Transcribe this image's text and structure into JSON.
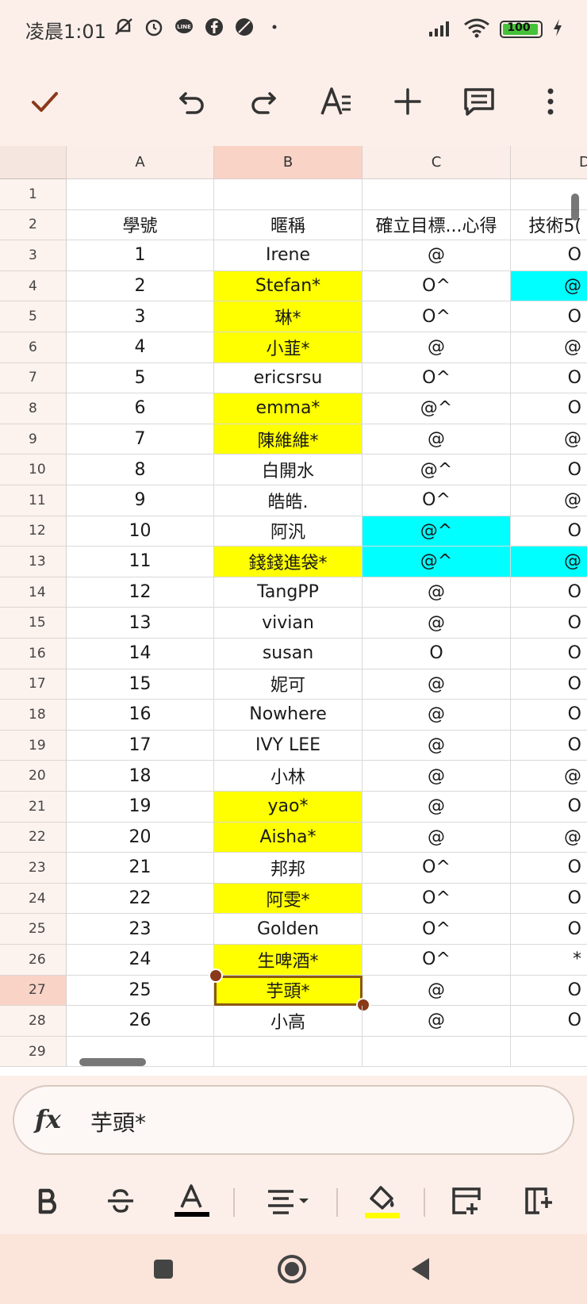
{
  "status": {
    "time": "凌晨1:01",
    "battery": "100",
    "icons_left": [
      "mute-icon",
      "alarm-icon",
      "line-icon",
      "facebook-icon",
      "leaf-icon",
      "dot-icon"
    ],
    "icons_right": [
      "signal-icon",
      "wifi-icon",
      "battery-icon",
      "charging-icon"
    ]
  },
  "toolbar": {
    "icons": [
      "check-icon",
      "undo-icon",
      "redo-icon",
      "text-format-icon",
      "insert-icon",
      "comment-icon",
      "more-icon"
    ]
  },
  "grid": {
    "columns": [
      "A",
      "B",
      "C",
      "D"
    ],
    "selected_column": "B",
    "selected_row": "27",
    "rows": [
      {
        "num": "1",
        "a": "",
        "b": "",
        "c": "",
        "d": "",
        "b_fill": "",
        "c_fill": "",
        "d_fill": ""
      },
      {
        "num": "2",
        "a": "學號",
        "b": "暱稱",
        "c": "確立目標...心得",
        "d": "技術5(",
        "b_fill": "",
        "c_fill": "",
        "d_fill": ""
      },
      {
        "num": "3",
        "a": "1",
        "b": "Irene",
        "c": "@",
        "d": "O",
        "b_fill": "",
        "c_fill": "",
        "d_fill": ""
      },
      {
        "num": "4",
        "a": "2",
        "b": "Stefan*",
        "c": "O^",
        "d": "@",
        "b_fill": "yellow",
        "c_fill": "",
        "d_fill": "cyan"
      },
      {
        "num": "5",
        "a": "3",
        "b": "琳*",
        "c": "O^",
        "d": "O",
        "b_fill": "yellow",
        "c_fill": "",
        "d_fill": ""
      },
      {
        "num": "6",
        "a": "4",
        "b": "小韮*",
        "c": "@",
        "d": "@",
        "b_fill": "yellow",
        "c_fill": "",
        "d_fill": ""
      },
      {
        "num": "7",
        "a": "5",
        "b": "ericsrsu",
        "c": "O^",
        "d": "O",
        "b_fill": "",
        "c_fill": "",
        "d_fill": ""
      },
      {
        "num": "8",
        "a": "6",
        "b": "emma*",
        "c": "@^",
        "d": "O",
        "b_fill": "yellow",
        "c_fill": "",
        "d_fill": ""
      },
      {
        "num": "9",
        "a": "7",
        "b": "陳維維*",
        "c": "@",
        "d": "@",
        "b_fill": "yellow",
        "c_fill": "",
        "d_fill": ""
      },
      {
        "num": "10",
        "a": "8",
        "b": "白開水",
        "c": "@^",
        "d": "O",
        "b_fill": "",
        "c_fill": "",
        "d_fill": ""
      },
      {
        "num": "11",
        "a": "9",
        "b": "皓皓.",
        "c": "O^",
        "d": "@",
        "b_fill": "",
        "c_fill": "",
        "d_fill": ""
      },
      {
        "num": "12",
        "a": "10",
        "b": "阿汎",
        "c": "@^",
        "d": "O",
        "b_fill": "",
        "c_fill": "cyan",
        "d_fill": ""
      },
      {
        "num": "13",
        "a": "11",
        "b": "錢錢進袋*",
        "c": "@^",
        "d": "@",
        "b_fill": "yellow",
        "c_fill": "cyan",
        "d_fill": "cyan"
      },
      {
        "num": "14",
        "a": "12",
        "b": "TangPP",
        "c": "@",
        "d": "O",
        "b_fill": "",
        "c_fill": "",
        "d_fill": ""
      },
      {
        "num": "15",
        "a": "13",
        "b": "vivian",
        "c": "@",
        "d": "O",
        "b_fill": "",
        "c_fill": "",
        "d_fill": ""
      },
      {
        "num": "16",
        "a": "14",
        "b": "susan",
        "c": "O",
        "d": "O",
        "b_fill": "",
        "c_fill": "",
        "d_fill": ""
      },
      {
        "num": "17",
        "a": "15",
        "b": "妮可",
        "c": "@",
        "d": "O",
        "b_fill": "",
        "c_fill": "",
        "d_fill": ""
      },
      {
        "num": "18",
        "a": "16",
        "b": "Nowhere",
        "c": "@",
        "d": "O",
        "b_fill": "",
        "c_fill": "",
        "d_fill": ""
      },
      {
        "num": "19",
        "a": "17",
        "b": "IVY LEE",
        "c": "@",
        "d": "O",
        "b_fill": "",
        "c_fill": "",
        "d_fill": ""
      },
      {
        "num": "20",
        "a": "18",
        "b": "小林",
        "c": "@",
        "d": "@",
        "b_fill": "",
        "c_fill": "",
        "d_fill": ""
      },
      {
        "num": "21",
        "a": "19",
        "b": "yao*",
        "c": "@",
        "d": "O",
        "b_fill": "yellow",
        "c_fill": "",
        "d_fill": ""
      },
      {
        "num": "22",
        "a": "20",
        "b": "Aisha*",
        "c": "@",
        "d": "@",
        "b_fill": "yellow",
        "c_fill": "",
        "d_fill": ""
      },
      {
        "num": "23",
        "a": "21",
        "b": "邦邦",
        "c": "O^",
        "d": "O",
        "b_fill": "",
        "c_fill": "",
        "d_fill": ""
      },
      {
        "num": "24",
        "a": "22",
        "b": "阿雯*",
        "c": "O^",
        "d": "O",
        "b_fill": "yellow",
        "c_fill": "",
        "d_fill": ""
      },
      {
        "num": "25",
        "a": "23",
        "b": "Golden",
        "c": "O^",
        "d": "O",
        "b_fill": "",
        "c_fill": "",
        "d_fill": ""
      },
      {
        "num": "26",
        "a": "24",
        "b": "生啤酒*",
        "c": "O^",
        "d": "*",
        "b_fill": "yellow",
        "c_fill": "",
        "d_fill": ""
      },
      {
        "num": "27",
        "a": "25",
        "b": "芋頭*",
        "c": "@",
        "d": "O",
        "b_fill": "yellow",
        "c_fill": "",
        "d_fill": ""
      },
      {
        "num": "28",
        "a": "26",
        "b": "小高",
        "c": "@",
        "d": "O",
        "b_fill": "",
        "c_fill": "",
        "d_fill": ""
      },
      {
        "num": "29",
        "a": "",
        "b": "",
        "c": "",
        "d": "",
        "b_fill": "",
        "c_fill": "",
        "d_fill": ""
      }
    ]
  },
  "formula": {
    "label": "fx",
    "value": "芋頭*"
  },
  "format_bar": {
    "icons": [
      "bold-icon",
      "strikethrough-icon",
      "text-color-icon",
      "align-icon",
      "fill-color-icon",
      "insert-row-icon",
      "insert-column-icon"
    ],
    "text_color": "#000000",
    "fill_color": "#ffff00"
  },
  "colors": {
    "yellow": "#ffff00",
    "cyan": "#00ffff",
    "accent": "#8a3a1a"
  }
}
